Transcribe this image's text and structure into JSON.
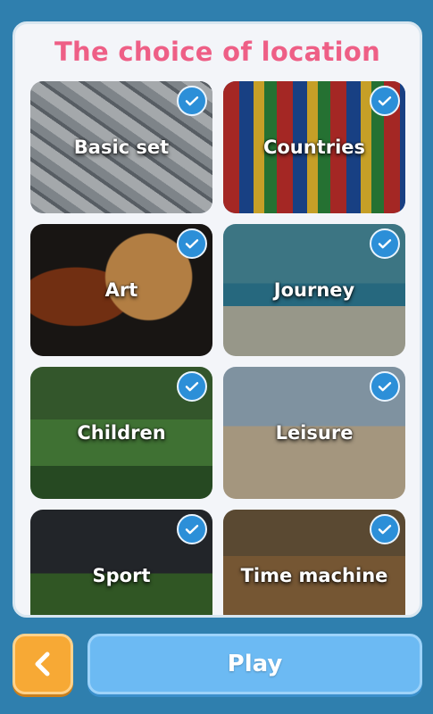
{
  "title": "The choice of location",
  "cards": [
    {
      "label": "Basic set",
      "selected": true,
      "icon": "check-icon"
    },
    {
      "label": "Countries",
      "selected": true,
      "icon": "check-icon"
    },
    {
      "label": "Art",
      "selected": true,
      "icon": "check-icon"
    },
    {
      "label": "Journey",
      "selected": true,
      "icon": "check-icon"
    },
    {
      "label": "Children",
      "selected": true,
      "icon": "check-icon"
    },
    {
      "label": "Leisure",
      "selected": true,
      "icon": "check-icon"
    },
    {
      "label": "Sport",
      "selected": true,
      "icon": "check-icon"
    },
    {
      "label": "Time machine",
      "selected": true,
      "icon": "check-icon"
    }
  ],
  "footer": {
    "back_icon": "chevron-left-icon",
    "play_label": "Play"
  },
  "colors": {
    "background": "#2f7fae",
    "title": "#ee5f86",
    "check": "#2c8fd8",
    "back_button": "#f7a935",
    "play_button": "#6cbaf3"
  }
}
